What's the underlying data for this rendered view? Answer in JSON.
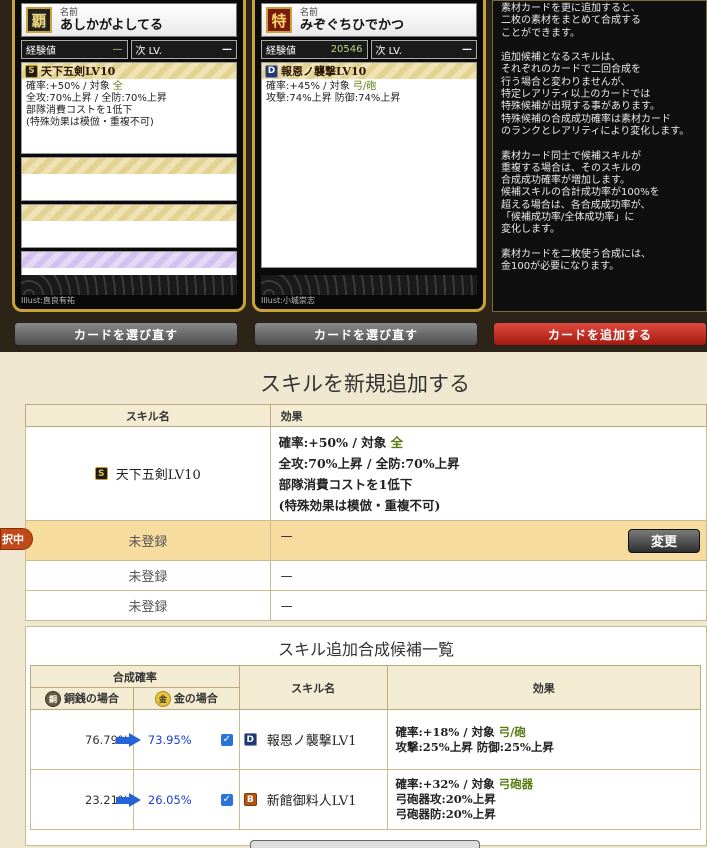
{
  "card1": {
    "emblem": "覇",
    "name_label": "名前",
    "name": "あしかがよしてる",
    "exp_label": "経験値",
    "exp_value": "—",
    "lv_label": "次 LV.",
    "lv_value": "—",
    "skill_rank": "S",
    "skill_name": "天下五剣LV10",
    "effect_prefix": "確率:+50% / 対象 ",
    "effect_target": "全",
    "effect_lines": "全攻:70%上昇 / 全防:70%上昇\n部隊消費コストを1低下\n(特殊効果は模倣・重複不可)",
    "illust": "Illust:直良有祐"
  },
  "card2": {
    "emblem": "特",
    "name_label": "名前",
    "name": "みぞぐちひでかつ",
    "exp_label": "経験値",
    "exp_value": "20546",
    "lv_label": "次 LV.",
    "lv_value": "—",
    "skill_rank": "D",
    "skill_name": "報恩ノ襲撃LV10",
    "effect_prefix": "確率:+45% / 対象 ",
    "effect_target": "弓/砲",
    "effect_lines": "攻撃:74%上昇 防御:74%上昇",
    "illust": "Illust:小城崇志"
  },
  "info_text": "素材カードを更に追加すると、\n二枚の素材をまとめて合成する\nことができます。\n\n追加候補となるスキルは、\nそれぞれのカードで二回合成を\n行う場合と変わりませんが、\n特定レアリティ以上のカードでは\n特殊候補が出現する事があります。\n特殊候補の合成成功確率は素材カード\nのランクとレアリティにより変化します。\n\n素材カード同士で候補スキルが\n重複する場合は、そのスキルの\n合成成功確率が増加します。\n候補スキルの合計成功率が100%を\n超える場合は、各合成成功率が、\n「候補成功率/全体成功率」に\n変化します。\n\n素材カードを二枚使う合成には、\n金100が必要になります。",
  "buttons": {
    "reselect1": "カードを選び直す",
    "reselect2": "カードを選び直す",
    "add_card": "カードを追加する",
    "change": "変更"
  },
  "section_title": "スキルを新規追加する",
  "table1": {
    "col_skill": "スキル名",
    "col_effect": "効果",
    "row1_rank": "S",
    "row1_skill": "天下五剣LV10",
    "row1_effect_prefix": "確率:+50% / 対象 ",
    "row1_effect_target": "全",
    "row1_effect_lines": "全攻:70%上昇 / 全防:70%上昇\n部隊消費コストを1低下\n(特殊効果は模倣・重複不可)",
    "unregistered": "未登録",
    "dash": "—",
    "selected_marker": "択中"
  },
  "panel2": {
    "title": "スキル追加合成候補一覧",
    "col_rate": "合成確率",
    "col_copper": "銅銭の場合",
    "col_gold": "金の場合",
    "coin_cu": "銅",
    "coin_au": "金",
    "col_skill": "スキル名",
    "col_effect": "効果",
    "rows": [
      {
        "copper": "76.79%",
        "gold": "73.95%",
        "rank": "D",
        "skill": "報恩ノ襲撃LV1",
        "ef_prefix": "確率:+18% / 対象 ",
        "ef_target": "弓/砲",
        "ef_lines": "攻撃:25%上昇 防御:25%上昇"
      },
      {
        "copper": "23.21%",
        "gold": "26.05%",
        "rank": "B",
        "skill": "新館御料人LV1",
        "ef_prefix": "確率:+32% / 対象 ",
        "ef_target": "弓砲器",
        "ef_lines": "弓砲器攻:20%上昇\n弓砲器防:20%上昇"
      }
    ]
  },
  "colors": {
    "accent_red": "#c0281c",
    "gold_frame": "#c9a23a",
    "percent_blue": "#1a3cd6"
  }
}
